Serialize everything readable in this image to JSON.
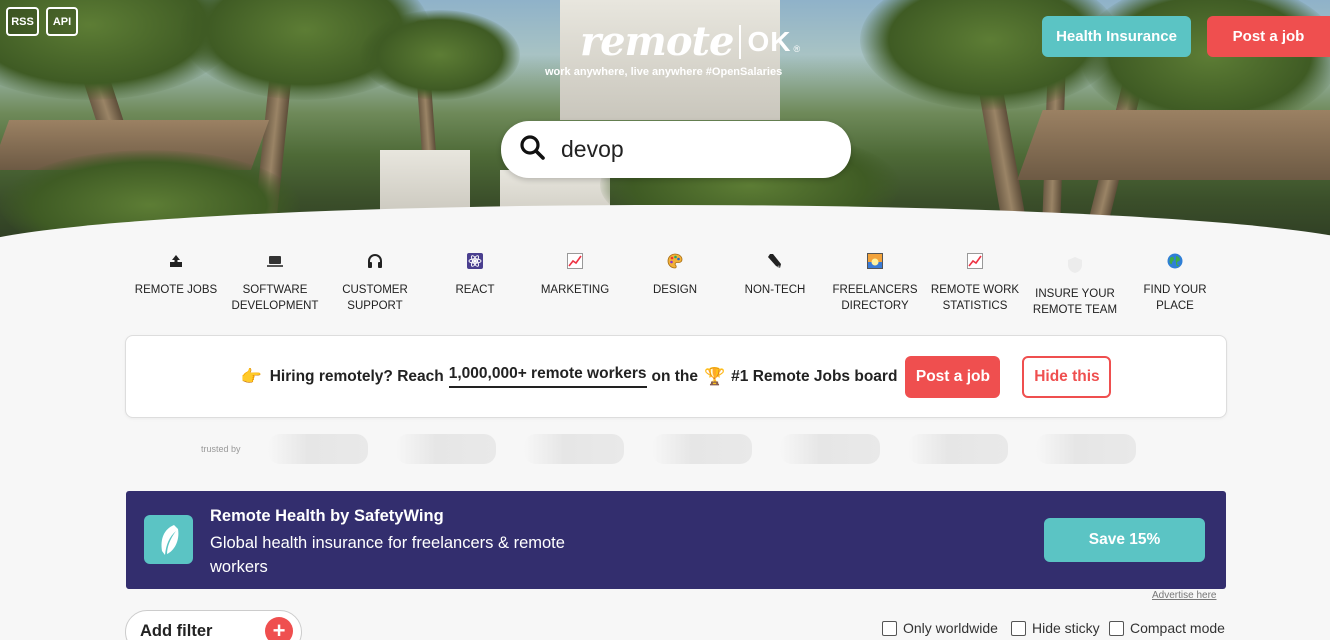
{
  "header": {
    "rss_label": "RSS",
    "api_label": "API",
    "logo_word": "remote",
    "logo_ok": "OK",
    "logo_reg": "®",
    "tagline": "work anywhere, live anywhere #OpenSalaries",
    "health_insurance_label": "Health Insurance",
    "post_job_label": "Post a job"
  },
  "search": {
    "value": "devop",
    "icon": "search-icon"
  },
  "categories": [
    {
      "label": "REMOTE JOBS",
      "icon": "upload-icon"
    },
    {
      "label": "SOFTWARE DEVELOPMENT",
      "icon": "laptop-icon"
    },
    {
      "label": "CUSTOMER SUPPORT",
      "icon": "headphones-icon"
    },
    {
      "label": "REACT",
      "icon": "react-icon"
    },
    {
      "label": "MARKETING",
      "icon": "chart-icon"
    },
    {
      "label": "DESIGN",
      "icon": "palette-icon"
    },
    {
      "label": "NON-TECH",
      "icon": "pen-icon"
    },
    {
      "label": "FREELANCERS DIRECTORY",
      "icon": "sunset-icon"
    },
    {
      "label": "REMOTE WORK STATISTICS",
      "icon": "chart-icon"
    },
    {
      "label": "INSURE YOUR REMOTE TEAM",
      "icon": "shield-icon"
    },
    {
      "label": "FIND YOUR PLACE",
      "icon": "globe-icon"
    }
  ],
  "hiring": {
    "emoji": "👉",
    "text_before": "Hiring remotely? Reach",
    "highlight": "1,000,000+ remote workers",
    "text_middle": "on the",
    "trophy": "🏆",
    "text_after": "#1 Remote Jobs board",
    "post_label": "Post a job",
    "hide_label": "Hide this"
  },
  "trusted_by_label": "trusted by",
  "safetywing": {
    "title": "Remote Health by SafetyWing",
    "subtitle": "Global health insurance for freelancers & remote workers",
    "save_label": "Save 15%",
    "advertise_label": "Advertise here"
  },
  "filters": {
    "add_filter_label": "Add filter",
    "add_icon": "+",
    "only_worldwide": "Only worldwide",
    "hide_sticky": "Hide sticky",
    "compact_mode": "Compact mode"
  },
  "colors": {
    "accent_red": "#ef4f4f",
    "accent_teal": "#5bc4c4",
    "banner_purple": "#332e6e"
  }
}
